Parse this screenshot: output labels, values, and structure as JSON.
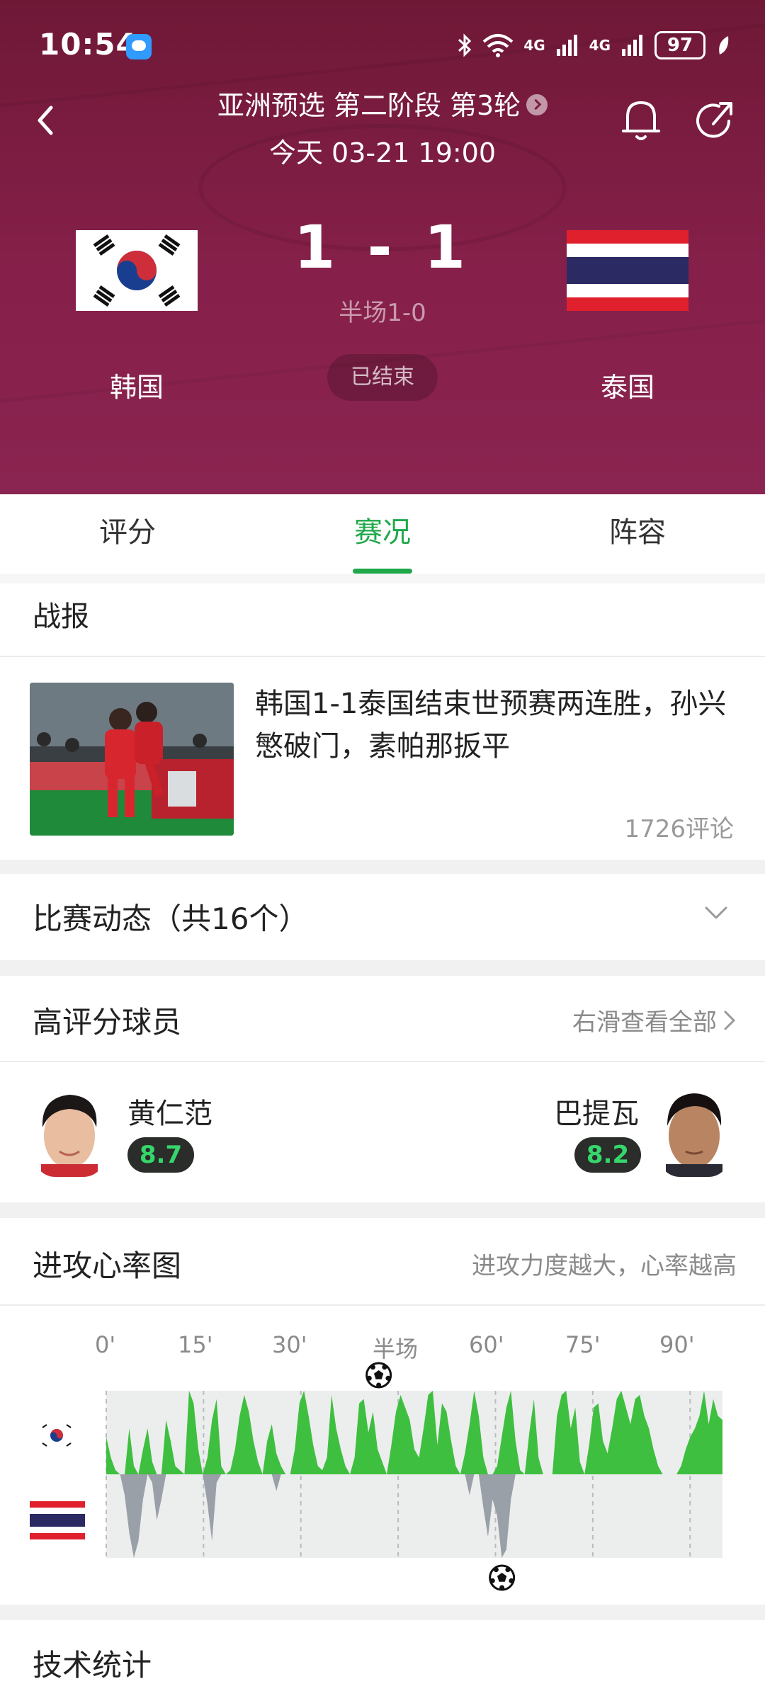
{
  "status_bar": {
    "time": "10:54",
    "network1": "4G",
    "network2": "4G",
    "battery": "97"
  },
  "match": {
    "league": "亚洲预选 第二阶段 第3轮",
    "datetime": "今天 03-21 19:00",
    "score": "1 - 1",
    "halftime": "半场1-0",
    "status": "已结束",
    "home_team": "韩国",
    "away_team": "泰国"
  },
  "tabs": [
    {
      "label": "评分"
    },
    {
      "label": "赛况",
      "active": true
    },
    {
      "label": "阵容"
    }
  ],
  "report": {
    "title": "战报",
    "news_title": "韩国1-1泰国结束世预赛两连胜，孙兴慜破门，素帕那扳平",
    "comments": "1726评论"
  },
  "events": {
    "title": "比赛动态（共16个）"
  },
  "top_players": {
    "title": "高评分球员",
    "more": "右滑查看全部",
    "home": {
      "name": "黄仁范",
      "rating": "8.7"
    },
    "away": {
      "name": "巴提瓦",
      "rating": "8.2"
    }
  },
  "heart_rate": {
    "title": "进攻心率图",
    "hint": "进攻力度越大，心率越高",
    "ticks": [
      "0'",
      "15'",
      "30'",
      "半场",
      "60'",
      "75'",
      "90'"
    ]
  },
  "tech_stats": {
    "title": "技术统计"
  },
  "colors": {
    "header": "#86204a",
    "accent": "#1fa84a",
    "home_bar": "#3fbf3f",
    "away_bar": "#9aa0a8"
  },
  "chart_data": {
    "type": "area",
    "x_ticks": [
      "0'",
      "15'",
      "30'",
      "半场",
      "60'",
      "75'",
      "90'"
    ],
    "series": [
      {
        "name": "韩国",
        "values": [
          0.45,
          0.2,
          0.05,
          0.0,
          0.0,
          0.55,
          0.1,
          0.0,
          0.3,
          0.55,
          0.15,
          0.0,
          0.0,
          0.65,
          0.4,
          0.1,
          0.05,
          0.0,
          1.0,
          0.85,
          0.3,
          0.0,
          0.2,
          0.65,
          0.9,
          0.1,
          0.0,
          0.05,
          0.3,
          0.7,
          0.95,
          0.75,
          0.4,
          0.15,
          0.0,
          0.4,
          0.6,
          0.25,
          0.1,
          0.0,
          0.0,
          0.3,
          0.85,
          1.0,
          0.7,
          0.35,
          0.1,
          0.05,
          0.2,
          0.95,
          0.55,
          0.3,
          0.1,
          0.0,
          0.2,
          0.85,
          0.9,
          0.5,
          0.75,
          0.3,
          0.15,
          0.0,
          0.35,
          0.75,
          0.95,
          0.8,
          0.65,
          0.3,
          0.2,
          0.55,
          0.95,
          1.0,
          0.35,
          0.85,
          0.75,
          0.4,
          0.1,
          0.0,
          0.25,
          0.6,
          1.0,
          0.7,
          0.2,
          0.0,
          0.0,
          0.1,
          0.45,
          0.8,
          1.0,
          0.4,
          0.05,
          0.0,
          0.5,
          0.9,
          0.2,
          0.0,
          0.0,
          0.0,
          0.7,
          0.95,
          1.0,
          0.55,
          0.8,
          0.15,
          0.0,
          0.35,
          0.8,
          0.85,
          0.4,
          0.25,
          0.55,
          0.9,
          1.0,
          0.8,
          0.6,
          0.9,
          0.95,
          0.7,
          0.55,
          0.3,
          0.1,
          0.0,
          0.0,
          0.0,
          0.0,
          0.1,
          0.3,
          0.45,
          0.55,
          0.7,
          1.0,
          0.6,
          0.9,
          0.7,
          0.65
        ]
      },
      {
        "name": "泰国",
        "values": [
          0.0,
          0.0,
          0.0,
          0.0,
          0.25,
          0.7,
          1.0,
          0.8,
          0.3,
          0.0,
          0.1,
          0.55,
          0.3,
          0.0,
          0.0,
          0.0,
          0.0,
          0.0,
          0.0,
          0.0,
          0.0,
          0.0,
          0.35,
          0.8,
          0.1,
          0.0,
          0.0,
          0.0,
          0.0,
          0.0,
          0.0,
          0.0,
          0.0,
          0.0,
          0.0,
          0.0,
          0.0,
          0.2,
          0.0,
          0.0,
          0.0,
          0.0,
          0.0,
          0.0,
          0.0,
          0.0,
          0.0,
          0.0,
          0.0,
          0.0,
          0.0,
          0.0,
          0.0,
          0.0,
          0.0,
          0.0,
          0.0,
          0.0,
          0.0,
          0.0,
          0.0,
          0.0,
          0.0,
          0.0,
          0.0,
          0.0,
          0.0,
          0.0,
          0.0,
          0.0,
          0.0,
          0.0,
          0.0,
          0.0,
          0.0,
          0.0,
          0.0,
          0.0,
          0.0,
          0.25,
          0.0,
          0.0,
          0.4,
          0.75,
          0.3,
          0.5,
          1.0,
          0.9,
          0.3,
          0.0,
          0.0,
          0.0,
          0.0,
          0.0,
          0.0,
          0.0,
          0.0,
          0.0,
          0.0,
          0.0,
          0.0,
          0.0,
          0.0,
          0.0,
          0.0,
          0.0,
          0.0,
          0.0,
          0.0,
          0.0,
          0.0,
          0.0,
          0.0,
          0.0,
          0.0,
          0.0,
          0.0,
          0.0,
          0.0,
          0.0,
          0.0,
          0.0,
          0.0,
          0.0,
          0.0,
          0.0,
          0.0,
          0.0,
          0.0,
          0.0,
          0.0,
          0.0,
          0.0,
          0.0,
          0.0,
          0.0,
          0.0,
          0.0,
          0.0
        ]
      }
    ],
    "goal_markers": [
      {
        "team": "韩国",
        "minute": 42
      },
      {
        "team": "泰国",
        "minute": 61
      }
    ]
  }
}
